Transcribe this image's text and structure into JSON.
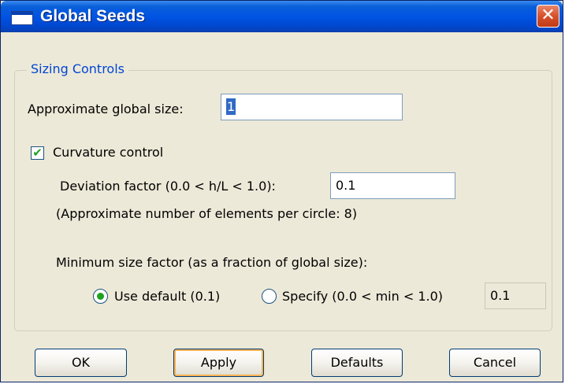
{
  "window": {
    "title": "Global Seeds",
    "close_glyph": "✕",
    "app_icon": "window-icon"
  },
  "sizing_controls": {
    "legend": "Sizing Controls",
    "approx_size_label": "Approximate global size:",
    "approx_size_value": "1",
    "curvature_label": "Curvature control",
    "curvature_checked": true,
    "deviation_label": "Deviation factor (0.0 < h/L < 1.0):",
    "deviation_value": "0.1",
    "elements_note": "(Approximate number of elements per circle: 8)",
    "min_size_label": "Minimum size factor (as a fraction of global size):",
    "use_default_label": "Use default (0.1)",
    "use_default_selected": true,
    "specify_label": "Specify (0.0 < min < 1.0)",
    "specify_value": "0.1"
  },
  "buttons": {
    "ok": "OK",
    "apply": "Apply",
    "defaults": "Defaults",
    "cancel": "Cancel"
  },
  "colors": {
    "titlebar": "#0054e3",
    "legend_text": "#0046d5",
    "check_mark": "#21a121",
    "dialog_bg": "#ece9d8"
  }
}
